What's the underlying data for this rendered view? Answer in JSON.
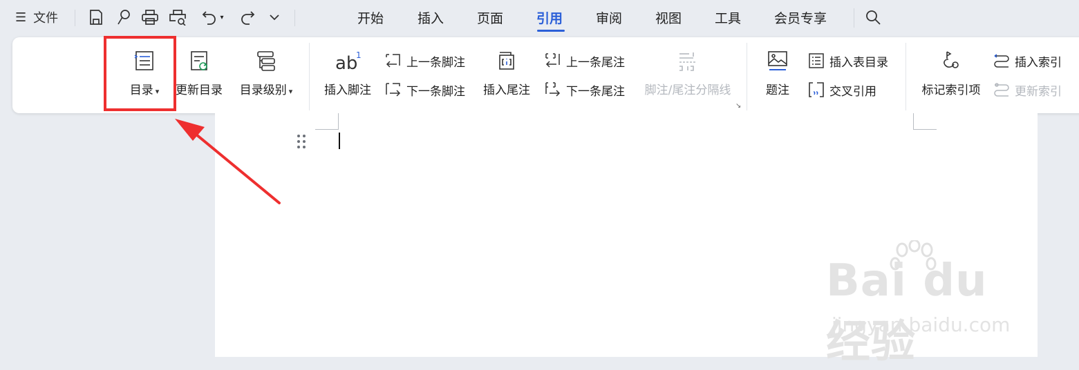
{
  "titlebar": {
    "file_label": "文件",
    "tabs": [
      "开始",
      "插入",
      "页面",
      "引用",
      "审阅",
      "视图",
      "工具",
      "会员专享"
    ],
    "active_tab": "引用",
    "accent_color": "#2b5fd8"
  },
  "ribbon": {
    "toc": "目录",
    "update_toc": "更新目录",
    "toc_level": "目录级别",
    "insert_footnote": "插入脚注",
    "prev_footnote": "上一条脚注",
    "next_footnote": "下一条脚注",
    "insert_endnote": "插入尾注",
    "prev_endnote": "上一条尾注",
    "next_endnote": "下一条尾注",
    "separator": "脚注/尾注分隔线",
    "caption": "题注",
    "insert_table_of_figures": "插入表目录",
    "cross_reference": "交叉引用",
    "mark_index_entry": "标记索引项",
    "insert_index": "插入索引",
    "update_index": "更新索引"
  },
  "watermark": {
    "logo_text": "Bai du 经验",
    "url": "jingyan.baidu.com"
  },
  "annotation": {
    "highlight_color": "#ee2f2f"
  }
}
